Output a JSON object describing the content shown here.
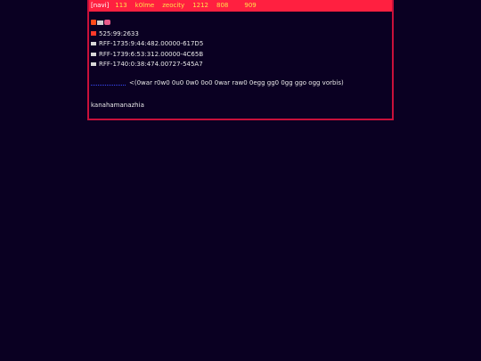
{
  "topbar": {
    "current": "[navi]",
    "items": [
      "113",
      "k0lme",
      "zeocity",
      "1212",
      "808",
      "",
      "909"
    ]
  },
  "content": {
    "lines": [
      "525:99:2633",
      "RFF-1735:9:44:482.00000-617D5",
      "RFF-1739:6:53:312.00000-4C65B",
      "RFF-1740:0:38:474.00727-545A7"
    ],
    "vector_link": "",
    "vector_text": "<(0war r0w0 0u0 0w0 0o0 0war raw0 0egg gg0 0gg ggo ogg vorbis)",
    "footer": "kanahamanazhia"
  },
  "colors": {
    "background": "#0a0022",
    "topbar": "#ff2040",
    "border": "#c8103a",
    "nav_text": "#ffe04a",
    "link": "#3a4bff"
  }
}
